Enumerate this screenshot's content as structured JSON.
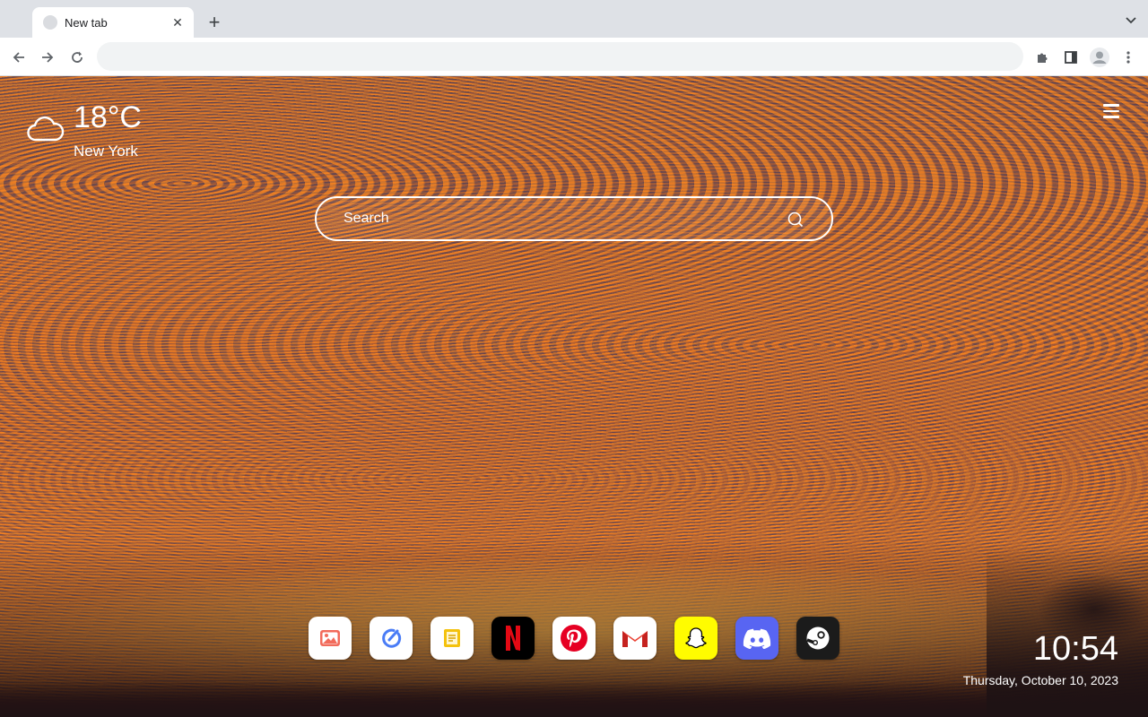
{
  "browser": {
    "tab_title": "New tab",
    "tab_close_icon": "close-icon",
    "new_tab_icon": "plus-icon",
    "tab_search_icon": "chevron-down-icon",
    "omnibox_value": "",
    "nav": [
      "back-icon",
      "forward-icon",
      "reload-icon"
    ],
    "toolbar_icons": [
      "extensions-icon",
      "side-panel-icon",
      "profile-avatar-icon",
      "more-menu-icon"
    ]
  },
  "weather": {
    "temperature": "18°C",
    "city": "New York",
    "icon": "cloud-icon"
  },
  "search": {
    "placeholder": "Search",
    "icon": "search-icon"
  },
  "apps": [
    {
      "name": "Photos",
      "icon": "photos-icon",
      "bg": "#ffffff"
    },
    {
      "name": "Tasks",
      "icon": "tasks-icon",
      "bg": "#ffffff"
    },
    {
      "name": "Notes",
      "icon": "notes-icon",
      "bg": "#ffffff"
    },
    {
      "name": "Netflix",
      "icon": "netflix-icon",
      "bg": "#000000"
    },
    {
      "name": "Pinterest",
      "icon": "pinterest-icon",
      "bg": "#ffffff"
    },
    {
      "name": "Gmail",
      "icon": "gmail-icon",
      "bg": "#ffffff"
    },
    {
      "name": "Snapchat",
      "icon": "snapchat-icon",
      "bg": "#fffc00"
    },
    {
      "name": "Discord",
      "icon": "discord-icon",
      "bg": "#5865f2"
    },
    {
      "name": "Steam",
      "icon": "steam-icon",
      "bg": "#1b1b1b"
    }
  ],
  "clock": {
    "time": "10:54",
    "date": "Thursday, October 10, 2023"
  },
  "colors": {
    "netflix_red": "#e50914",
    "pinterest_red": "#e60023",
    "notes_yellow": "#f4c20d",
    "tasks_blue": "#4a7cf6"
  }
}
